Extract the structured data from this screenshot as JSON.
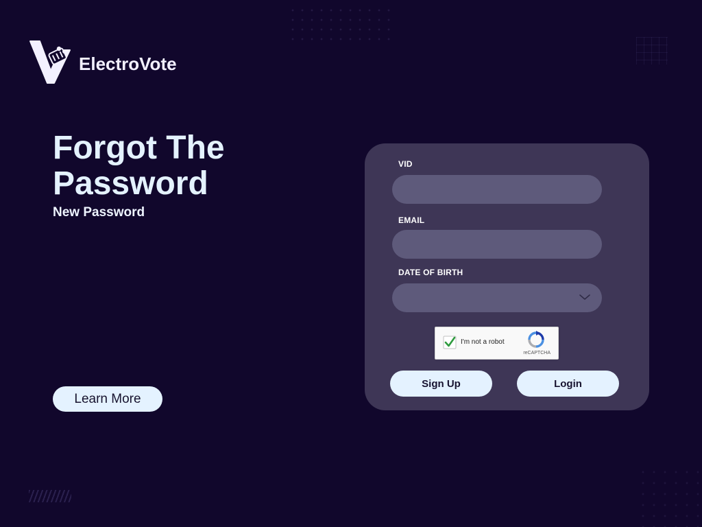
{
  "brand": {
    "name": "ElectroVote",
    "logo_icon": "v-ballot-logo-icon"
  },
  "hero": {
    "title": "Forgot The Password",
    "subtitle": "New Password",
    "learn_more_label": "Learn More"
  },
  "form": {
    "vid_label": "VID",
    "vid_value": "",
    "email_label": "EMAIL",
    "email_value": "",
    "dob_label": "DATE OF BIRTH",
    "dob_value": "",
    "dob_icon": "chevron-down-icon",
    "captcha": {
      "checked": true,
      "text": "I'm not a robot",
      "brand": "reCAPTCHA"
    },
    "signup_label": "Sign Up",
    "login_label": "Login"
  },
  "colors": {
    "background": "#11072c",
    "card": "#3e3656",
    "field": "#5e5a7b",
    "accent": "#e4f2ff"
  }
}
